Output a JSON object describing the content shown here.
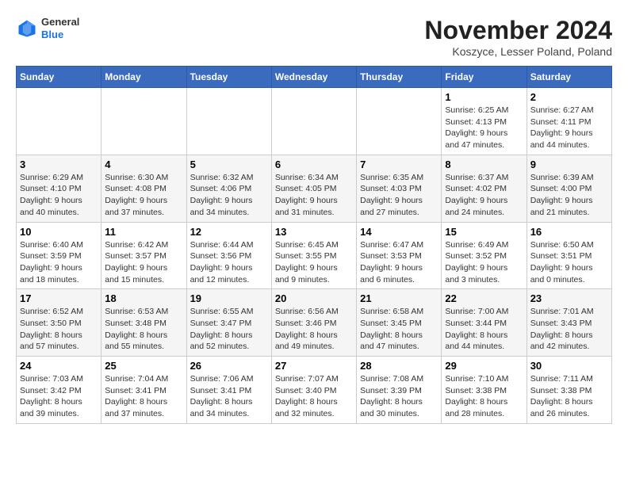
{
  "logo": {
    "general": "General",
    "blue": "Blue"
  },
  "header": {
    "month_title": "November 2024",
    "subtitle": "Koszyce, Lesser Poland, Poland"
  },
  "weekdays": [
    "Sunday",
    "Monday",
    "Tuesday",
    "Wednesday",
    "Thursday",
    "Friday",
    "Saturday"
  ],
  "weeks": [
    [
      {
        "day": "",
        "info": ""
      },
      {
        "day": "",
        "info": ""
      },
      {
        "day": "",
        "info": ""
      },
      {
        "day": "",
        "info": ""
      },
      {
        "day": "",
        "info": ""
      },
      {
        "day": "1",
        "info": "Sunrise: 6:25 AM\nSunset: 4:13 PM\nDaylight: 9 hours\nand 47 minutes."
      },
      {
        "day": "2",
        "info": "Sunrise: 6:27 AM\nSunset: 4:11 PM\nDaylight: 9 hours\nand 44 minutes."
      }
    ],
    [
      {
        "day": "3",
        "info": "Sunrise: 6:29 AM\nSunset: 4:10 PM\nDaylight: 9 hours\nand 40 minutes."
      },
      {
        "day": "4",
        "info": "Sunrise: 6:30 AM\nSunset: 4:08 PM\nDaylight: 9 hours\nand 37 minutes."
      },
      {
        "day": "5",
        "info": "Sunrise: 6:32 AM\nSunset: 4:06 PM\nDaylight: 9 hours\nand 34 minutes."
      },
      {
        "day": "6",
        "info": "Sunrise: 6:34 AM\nSunset: 4:05 PM\nDaylight: 9 hours\nand 31 minutes."
      },
      {
        "day": "7",
        "info": "Sunrise: 6:35 AM\nSunset: 4:03 PM\nDaylight: 9 hours\nand 27 minutes."
      },
      {
        "day": "8",
        "info": "Sunrise: 6:37 AM\nSunset: 4:02 PM\nDaylight: 9 hours\nand 24 minutes."
      },
      {
        "day": "9",
        "info": "Sunrise: 6:39 AM\nSunset: 4:00 PM\nDaylight: 9 hours\nand 21 minutes."
      }
    ],
    [
      {
        "day": "10",
        "info": "Sunrise: 6:40 AM\nSunset: 3:59 PM\nDaylight: 9 hours\nand 18 minutes."
      },
      {
        "day": "11",
        "info": "Sunrise: 6:42 AM\nSunset: 3:57 PM\nDaylight: 9 hours\nand 15 minutes."
      },
      {
        "day": "12",
        "info": "Sunrise: 6:44 AM\nSunset: 3:56 PM\nDaylight: 9 hours\nand 12 minutes."
      },
      {
        "day": "13",
        "info": "Sunrise: 6:45 AM\nSunset: 3:55 PM\nDaylight: 9 hours\nand 9 minutes."
      },
      {
        "day": "14",
        "info": "Sunrise: 6:47 AM\nSunset: 3:53 PM\nDaylight: 9 hours\nand 6 minutes."
      },
      {
        "day": "15",
        "info": "Sunrise: 6:49 AM\nSunset: 3:52 PM\nDaylight: 9 hours\nand 3 minutes."
      },
      {
        "day": "16",
        "info": "Sunrise: 6:50 AM\nSunset: 3:51 PM\nDaylight: 9 hours\nand 0 minutes."
      }
    ],
    [
      {
        "day": "17",
        "info": "Sunrise: 6:52 AM\nSunset: 3:50 PM\nDaylight: 8 hours\nand 57 minutes."
      },
      {
        "day": "18",
        "info": "Sunrise: 6:53 AM\nSunset: 3:48 PM\nDaylight: 8 hours\nand 55 minutes."
      },
      {
        "day": "19",
        "info": "Sunrise: 6:55 AM\nSunset: 3:47 PM\nDaylight: 8 hours\nand 52 minutes."
      },
      {
        "day": "20",
        "info": "Sunrise: 6:56 AM\nSunset: 3:46 PM\nDaylight: 8 hours\nand 49 minutes."
      },
      {
        "day": "21",
        "info": "Sunrise: 6:58 AM\nSunset: 3:45 PM\nDaylight: 8 hours\nand 47 minutes."
      },
      {
        "day": "22",
        "info": "Sunrise: 7:00 AM\nSunset: 3:44 PM\nDaylight: 8 hours\nand 44 minutes."
      },
      {
        "day": "23",
        "info": "Sunrise: 7:01 AM\nSunset: 3:43 PM\nDaylight: 8 hours\nand 42 minutes."
      }
    ],
    [
      {
        "day": "24",
        "info": "Sunrise: 7:03 AM\nSunset: 3:42 PM\nDaylight: 8 hours\nand 39 minutes."
      },
      {
        "day": "25",
        "info": "Sunrise: 7:04 AM\nSunset: 3:41 PM\nDaylight: 8 hours\nand 37 minutes."
      },
      {
        "day": "26",
        "info": "Sunrise: 7:06 AM\nSunset: 3:41 PM\nDaylight: 8 hours\nand 34 minutes."
      },
      {
        "day": "27",
        "info": "Sunrise: 7:07 AM\nSunset: 3:40 PM\nDaylight: 8 hours\nand 32 minutes."
      },
      {
        "day": "28",
        "info": "Sunrise: 7:08 AM\nSunset: 3:39 PM\nDaylight: 8 hours\nand 30 minutes."
      },
      {
        "day": "29",
        "info": "Sunrise: 7:10 AM\nSunset: 3:38 PM\nDaylight: 8 hours\nand 28 minutes."
      },
      {
        "day": "30",
        "info": "Sunrise: 7:11 AM\nSunset: 3:38 PM\nDaylight: 8 hours\nand 26 minutes."
      }
    ]
  ]
}
